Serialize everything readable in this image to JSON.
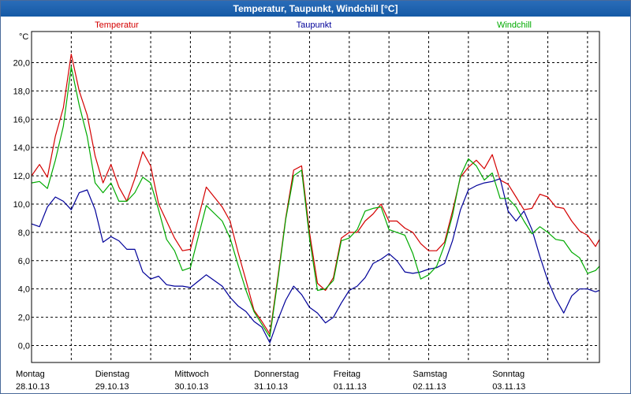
{
  "window": {
    "title": "Temperatur, Taupunkt, Windchill [°C]"
  },
  "chart_data": {
    "type": "line",
    "title": "Temperatur, Taupunkt, Windchill [°C]",
    "ylabel": "°C",
    "ylim": [
      -1.2,
      22.2
    ],
    "xlim": [
      0,
      7.15
    ],
    "grid": true,
    "legend": "top",
    "y_ticks": [
      "0,0",
      "2,0",
      "4,0",
      "6,0",
      "8,0",
      "10,0",
      "12,0",
      "14,0",
      "16,0",
      "18,0",
      "20,0"
    ],
    "x_ticks": [
      {
        "day": "Montag",
        "date": "28.10.13"
      },
      {
        "day": "Dienstag",
        "date": "29.10.13"
      },
      {
        "day": "Mittwoch",
        "date": "30.10.13"
      },
      {
        "day": "Donnerstag",
        "date": "31.10.13"
      },
      {
        "day": "Freitag",
        "date": "01.11.13"
      },
      {
        "day": "Samstag",
        "date": "02.11.13"
      },
      {
        "day": "Sonntag",
        "date": "03.11.13"
      }
    ],
    "series": [
      {
        "name": "Temperatur",
        "color": "#d40000",
        "x": [
          0,
          0.1,
          0.2,
          0.3,
          0.4,
          0.5,
          0.6,
          0.7,
          0.8,
          0.9,
          1.0,
          1.1,
          1.2,
          1.3,
          1.4,
          1.5,
          1.6,
          1.7,
          1.8,
          1.9,
          2.0,
          2.2,
          2.4,
          2.5,
          2.6,
          2.7,
          2.8,
          2.9,
          3.0,
          3.1,
          3.2,
          3.3,
          3.4,
          3.5,
          3.6,
          3.7,
          3.8,
          3.9,
          4.0,
          4.1,
          4.2,
          4.3,
          4.4,
          4.5,
          4.6,
          4.7,
          4.8,
          4.9,
          5.0,
          5.1,
          5.2,
          5.3,
          5.4,
          5.5,
          5.6,
          5.7,
          5.8,
          5.9,
          6.0,
          6.1,
          6.2,
          6.3,
          6.4,
          6.5,
          6.6,
          6.7,
          6.8,
          6.9,
          7.0,
          7.1,
          7.15
        ],
        "values": [
          12.0,
          12.8,
          11.9,
          14.8,
          16.8,
          20.6,
          18.0,
          16.3,
          13.4,
          11.5,
          12.8,
          11.2,
          10.2,
          11.8,
          13.7,
          12.7,
          10.0,
          8.8,
          7.6,
          6.7,
          6.8,
          11.2,
          9.8,
          8.8,
          6.6,
          4.6,
          2.5,
          1.7,
          0.8,
          4.8,
          9.0,
          12.4,
          12.7,
          8.0,
          4.4,
          3.9,
          4.8,
          7.6,
          8.0,
          8.0,
          8.8,
          9.3,
          10.0,
          8.8,
          8.8,
          8.3,
          8.0,
          7.2,
          6.7,
          6.7,
          7.3,
          9.5,
          11.9,
          12.6,
          13.1,
          12.5,
          13.5,
          11.7,
          11.4,
          10.5,
          9.6,
          9.7,
          10.7,
          10.5,
          9.8,
          9.7,
          8.8,
          8.1,
          7.8,
          7.0,
          7.5
        ]
      },
      {
        "name": "Taupunkt",
        "color": "#000099",
        "x": [
          0,
          0.1,
          0.2,
          0.3,
          0.4,
          0.5,
          0.6,
          0.7,
          0.8,
          0.9,
          1.0,
          1.1,
          1.2,
          1.3,
          1.4,
          1.5,
          1.6,
          1.7,
          1.8,
          1.9,
          2.0,
          2.2,
          2.4,
          2.5,
          2.6,
          2.7,
          2.8,
          2.9,
          3.0,
          3.1,
          3.2,
          3.3,
          3.4,
          3.5,
          3.6,
          3.7,
          3.8,
          3.9,
          4.0,
          4.1,
          4.2,
          4.3,
          4.4,
          4.5,
          4.6,
          4.7,
          4.8,
          4.9,
          5.0,
          5.1,
          5.2,
          5.3,
          5.4,
          5.5,
          5.6,
          5.7,
          5.8,
          5.9,
          6.0,
          6.1,
          6.2,
          6.3,
          6.4,
          6.5,
          6.6,
          6.7,
          6.8,
          6.9,
          7.0,
          7.1,
          7.15
        ],
        "values": [
          8.6,
          8.4,
          9.8,
          10.5,
          10.2,
          9.6,
          10.8,
          11.0,
          9.6,
          7.3,
          7.7,
          7.4,
          6.8,
          6.8,
          5.2,
          4.7,
          4.9,
          4.3,
          4.2,
          4.2,
          4.1,
          5.0,
          4.2,
          3.4,
          2.8,
          2.4,
          1.7,
          1.3,
          0.2,
          1.8,
          3.2,
          4.2,
          3.6,
          2.7,
          2.3,
          1.6,
          2.0,
          3.0,
          3.9,
          4.2,
          4.8,
          5.8,
          6.1,
          6.5,
          6.0,
          5.2,
          5.1,
          5.2,
          5.4,
          5.5,
          5.8,
          7.4,
          9.6,
          11.0,
          11.3,
          11.5,
          11.6,
          11.8,
          9.5,
          8.8,
          9.5,
          8.2,
          6.3,
          4.6,
          3.3,
          2.3,
          3.5,
          4.0,
          4.0,
          3.8,
          3.9
        ]
      },
      {
        "name": "Windchill",
        "color": "#00aa00",
        "x": [
          0,
          0.1,
          0.2,
          0.3,
          0.4,
          0.5,
          0.6,
          0.7,
          0.8,
          0.9,
          1.0,
          1.1,
          1.2,
          1.3,
          1.4,
          1.5,
          1.6,
          1.7,
          1.8,
          1.9,
          2.0,
          2.2,
          2.4,
          2.5,
          2.6,
          2.7,
          2.8,
          2.9,
          3.0,
          3.1,
          3.2,
          3.3,
          3.4,
          3.5,
          3.6,
          3.7,
          3.8,
          3.9,
          4.0,
          4.1,
          4.2,
          4.3,
          4.4,
          4.5,
          4.6,
          4.7,
          4.8,
          4.9,
          5.0,
          5.1,
          5.2,
          5.3,
          5.4,
          5.5,
          5.6,
          5.7,
          5.8,
          5.9,
          6.0,
          6.1,
          6.2,
          6.3,
          6.4,
          6.5,
          6.6,
          6.7,
          6.8,
          6.9,
          7.0,
          7.1,
          7.15
        ],
        "values": [
          11.5,
          11.6,
          11.1,
          13.1,
          15.5,
          19.7,
          17.0,
          14.8,
          11.5,
          10.8,
          11.5,
          10.2,
          10.2,
          10.8,
          11.9,
          11.5,
          9.6,
          7.5,
          6.7,
          5.3,
          5.5,
          9.9,
          8.8,
          7.6,
          5.7,
          3.9,
          2.4,
          1.5,
          0.6,
          4.6,
          8.9,
          12.0,
          12.4,
          7.6,
          3.9,
          4.0,
          4.6,
          7.4,
          7.6,
          8.2,
          9.5,
          9.7,
          9.8,
          8.2,
          8.0,
          7.8,
          6.5,
          4.7,
          5.0,
          5.6,
          7.1,
          9.2,
          12.0,
          13.2,
          12.7,
          11.7,
          12.2,
          10.4,
          10.4,
          9.8,
          8.8,
          7.9,
          8.4,
          8.0,
          7.5,
          7.4,
          6.6,
          6.2,
          5.1,
          5.3,
          5.6
        ]
      }
    ]
  }
}
